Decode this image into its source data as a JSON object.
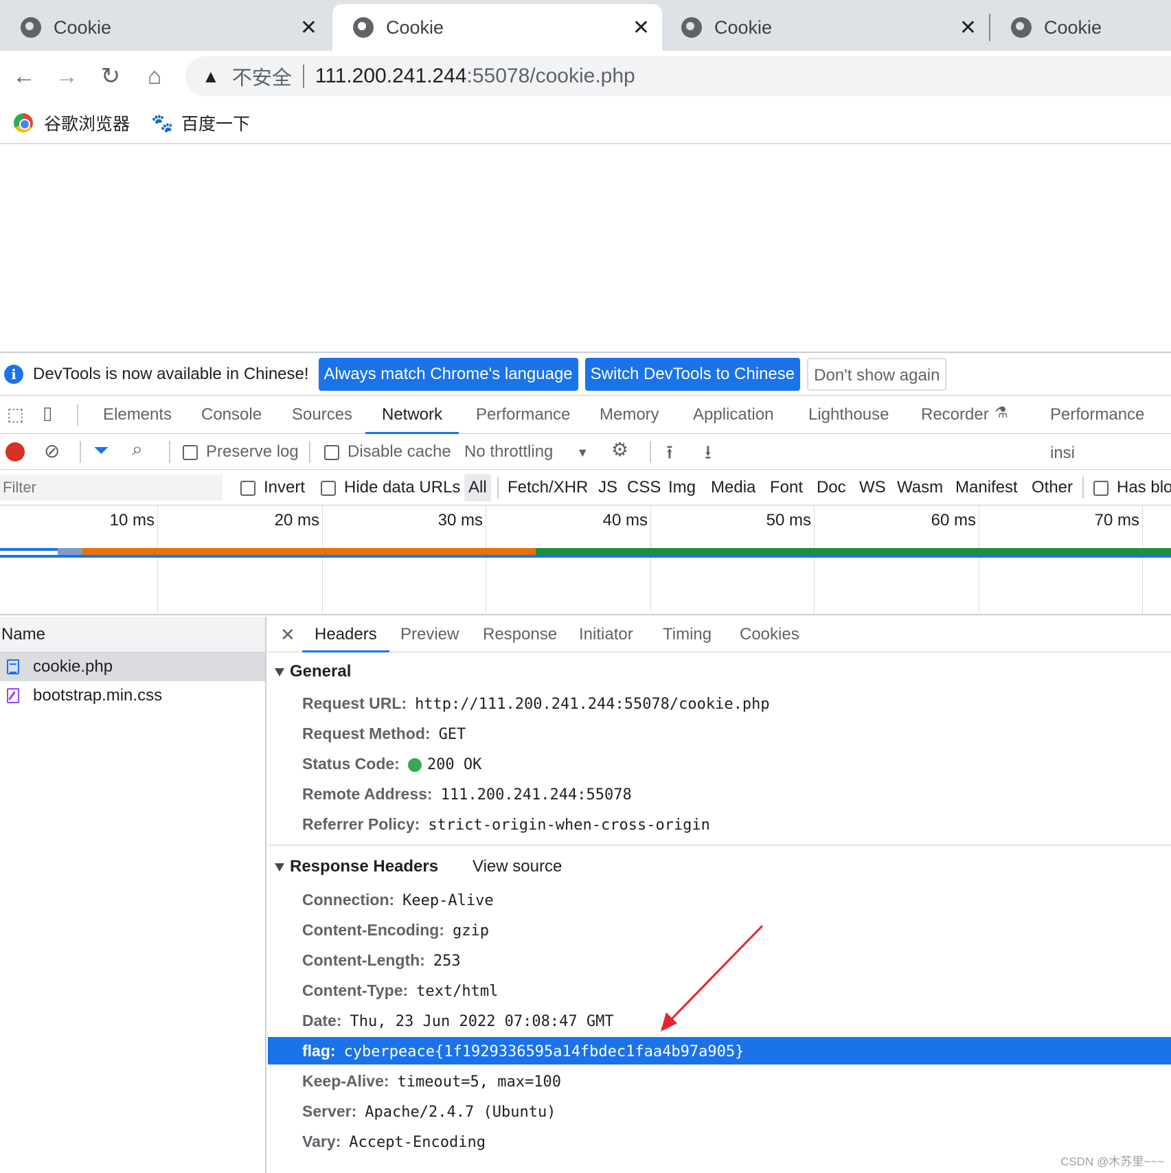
{
  "browser": {
    "tabs": [
      {
        "title": "Cookie"
      },
      {
        "title": "Cookie"
      },
      {
        "title": "Cookie"
      },
      {
        "title": "Cookie"
      }
    ],
    "close_glyph": "✕",
    "omnibox": {
      "insecure_label": "不安全",
      "host": "111.200.241.244",
      "path": ":55078/cookie.php"
    },
    "bookmarks": [
      {
        "label": "谷歌浏览器"
      },
      {
        "label": "百度一下"
      }
    ]
  },
  "devtools": {
    "infobar": {
      "message": "DevTools is now available in Chinese!",
      "btn_match": "Always match Chrome's language",
      "btn_switch": "Switch DevTools to Chinese",
      "btn_dismiss": "Don't show again"
    },
    "tabs": [
      "Elements",
      "Console",
      "Sources",
      "Network",
      "Performance",
      "Memory",
      "Application",
      "Lighthouse",
      "Recorder",
      "Performance insi"
    ],
    "active_tab": "Network",
    "network_toolbar": {
      "preserve_log": "Preserve log",
      "disable_cache": "Disable cache",
      "throttling": "No throttling"
    },
    "filterbar": {
      "placeholder": "Filter",
      "invert": "Invert",
      "hide_data_urls": "Hide data URLs",
      "types": [
        "All",
        "Fetch/XHR",
        "JS",
        "CSS",
        "Img",
        "Media",
        "Font",
        "Doc",
        "WS",
        "Wasm",
        "Manifest",
        "Other"
      ],
      "has_blocked": "Has blo"
    },
    "timeline_ticks": [
      "10 ms",
      "20 ms",
      "30 ms",
      "40 ms",
      "50 ms",
      "60 ms",
      "70 ms"
    ],
    "requests": {
      "header": "Name",
      "rows": [
        {
          "name": "cookie.php",
          "type": "document"
        },
        {
          "name": "bootstrap.min.css",
          "type": "stylesheet"
        }
      ]
    },
    "detail": {
      "tabs": [
        "Headers",
        "Preview",
        "Response",
        "Initiator",
        "Timing",
        "Cookies"
      ],
      "general": {
        "title": "General",
        "rows": [
          {
            "key": "Request URL:",
            "value": "http://111.200.241.244:55078/cookie.php"
          },
          {
            "key": "Request Method:",
            "value": "GET"
          },
          {
            "key": "Status Code:",
            "value": "200 OK"
          },
          {
            "key": "Remote Address:",
            "value": "111.200.241.244:55078"
          },
          {
            "key": "Referrer Policy:",
            "value": "strict-origin-when-cross-origin"
          }
        ]
      },
      "response_headers": {
        "title": "Response Headers",
        "view_source": "View source",
        "rows": [
          {
            "key": "Connection:",
            "value": "Keep-Alive"
          },
          {
            "key": "Content-Encoding:",
            "value": "gzip"
          },
          {
            "key": "Content-Length:",
            "value": "253"
          },
          {
            "key": "Content-Type:",
            "value": "text/html"
          },
          {
            "key": "Date:",
            "value": "Thu, 23 Jun 2022 07:08:47 GMT"
          },
          {
            "key": "flag:",
            "value": "cyberpeace{1f1929336595a14fbdec1faa4b97a905}"
          },
          {
            "key": "Keep-Alive:",
            "value": "timeout=5, max=100"
          },
          {
            "key": "Server:",
            "value": "Apache/2.4.7 (Ubuntu)"
          },
          {
            "key": "Vary:",
            "value": "Accept-Encoding"
          }
        ]
      }
    }
  },
  "watermark": "CSDN @木苏里~~~",
  "colors": {
    "accent": "#1a73e8",
    "highlight_row": "#1a73e8",
    "annotation_arrow": "#e8232a"
  }
}
